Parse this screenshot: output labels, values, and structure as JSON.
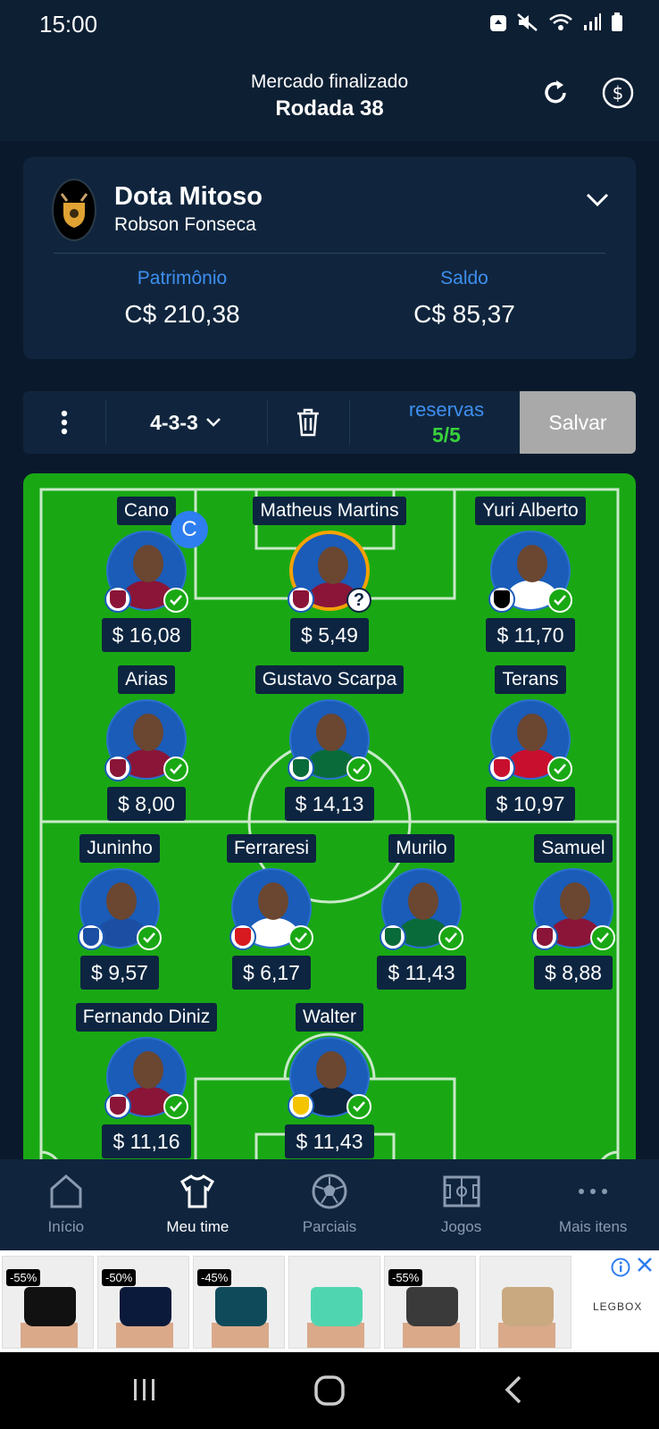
{
  "status_bar": {
    "time": "15:00"
  },
  "header": {
    "subtitle": "Mercado finalizado",
    "title": "Rodada 38"
  },
  "team": {
    "name": "Dota Mitoso",
    "owner": "Robson Fonseca",
    "patrimonio_label": "Patrimônio",
    "patrimonio_value": "C$ 210,38",
    "saldo_label": "Saldo",
    "saldo_value": "C$ 85,37"
  },
  "toolbar": {
    "formation": "4-3-3",
    "reserves_label": "reservas",
    "reserves_count": "5/5",
    "save_label": "Salvar"
  },
  "players": [
    {
      "name": "Cano",
      "price": "$ 16,08",
      "status": "ok",
      "captain": true,
      "captain_label": "C",
      "club_color": "#8a1538"
    },
    {
      "name": "Matheus Martins",
      "price": "$ 5,49",
      "status": "doubt",
      "doubt_label": "?",
      "club_color": "#8a1538"
    },
    {
      "name": "Yuri Alberto",
      "price": "$ 11,70",
      "status": "ok",
      "club_color": "#000000"
    },
    {
      "name": "Arias",
      "price": "$ 8,00",
      "status": "ok",
      "club_color": "#8a1538"
    },
    {
      "name": "Gustavo Scarpa",
      "price": "$ 14,13",
      "status": "ok",
      "club_color": "#0a6b3a"
    },
    {
      "name": "Terans",
      "price": "$ 10,97",
      "status": "ok",
      "club_color": "#c8102e"
    },
    {
      "name": "Juninho",
      "price": "$ 9,57",
      "status": "ok",
      "club_color": "#1c4fa3"
    },
    {
      "name": "Ferraresi",
      "price": "$ 6,17",
      "status": "ok",
      "club_color": "#d71920"
    },
    {
      "name": "Murilo",
      "price": "$ 11,43",
      "status": "ok",
      "club_color": "#0a6b3a"
    },
    {
      "name": "Samuel",
      "price": "$ 8,88",
      "status": "ok",
      "club_color": "#8a1538"
    },
    {
      "name": "Fernando Diniz",
      "price": "$ 11,16",
      "status": "ok",
      "club_color": "#8a1538"
    },
    {
      "name": "Walter",
      "price": "$ 11,43",
      "status": "ok",
      "club_color": "#f5c400"
    }
  ],
  "bottom_nav": [
    {
      "label": "Início",
      "icon": "home-icon",
      "active": false
    },
    {
      "label": "Meu time",
      "icon": "shirt-icon",
      "active": true
    },
    {
      "label": "Parciais",
      "icon": "soccer-ball-icon",
      "active": false
    },
    {
      "label": "Jogos",
      "icon": "field-icon",
      "active": false
    },
    {
      "label": "Mais itens",
      "icon": "more-icon",
      "active": false
    }
  ],
  "ad": {
    "brand": "LEGBOX",
    "items": [
      {
        "discount": "-55%"
      },
      {
        "discount": "-50%"
      },
      {
        "discount": "-45%"
      },
      {
        "discount": ""
      },
      {
        "discount": "-55%"
      },
      {
        "discount": ""
      }
    ]
  },
  "colors": {
    "accent": "#3d8ff0",
    "pitch": "#19a814",
    "reserves": "#39d13b",
    "captain": "#2e7ef0"
  }
}
